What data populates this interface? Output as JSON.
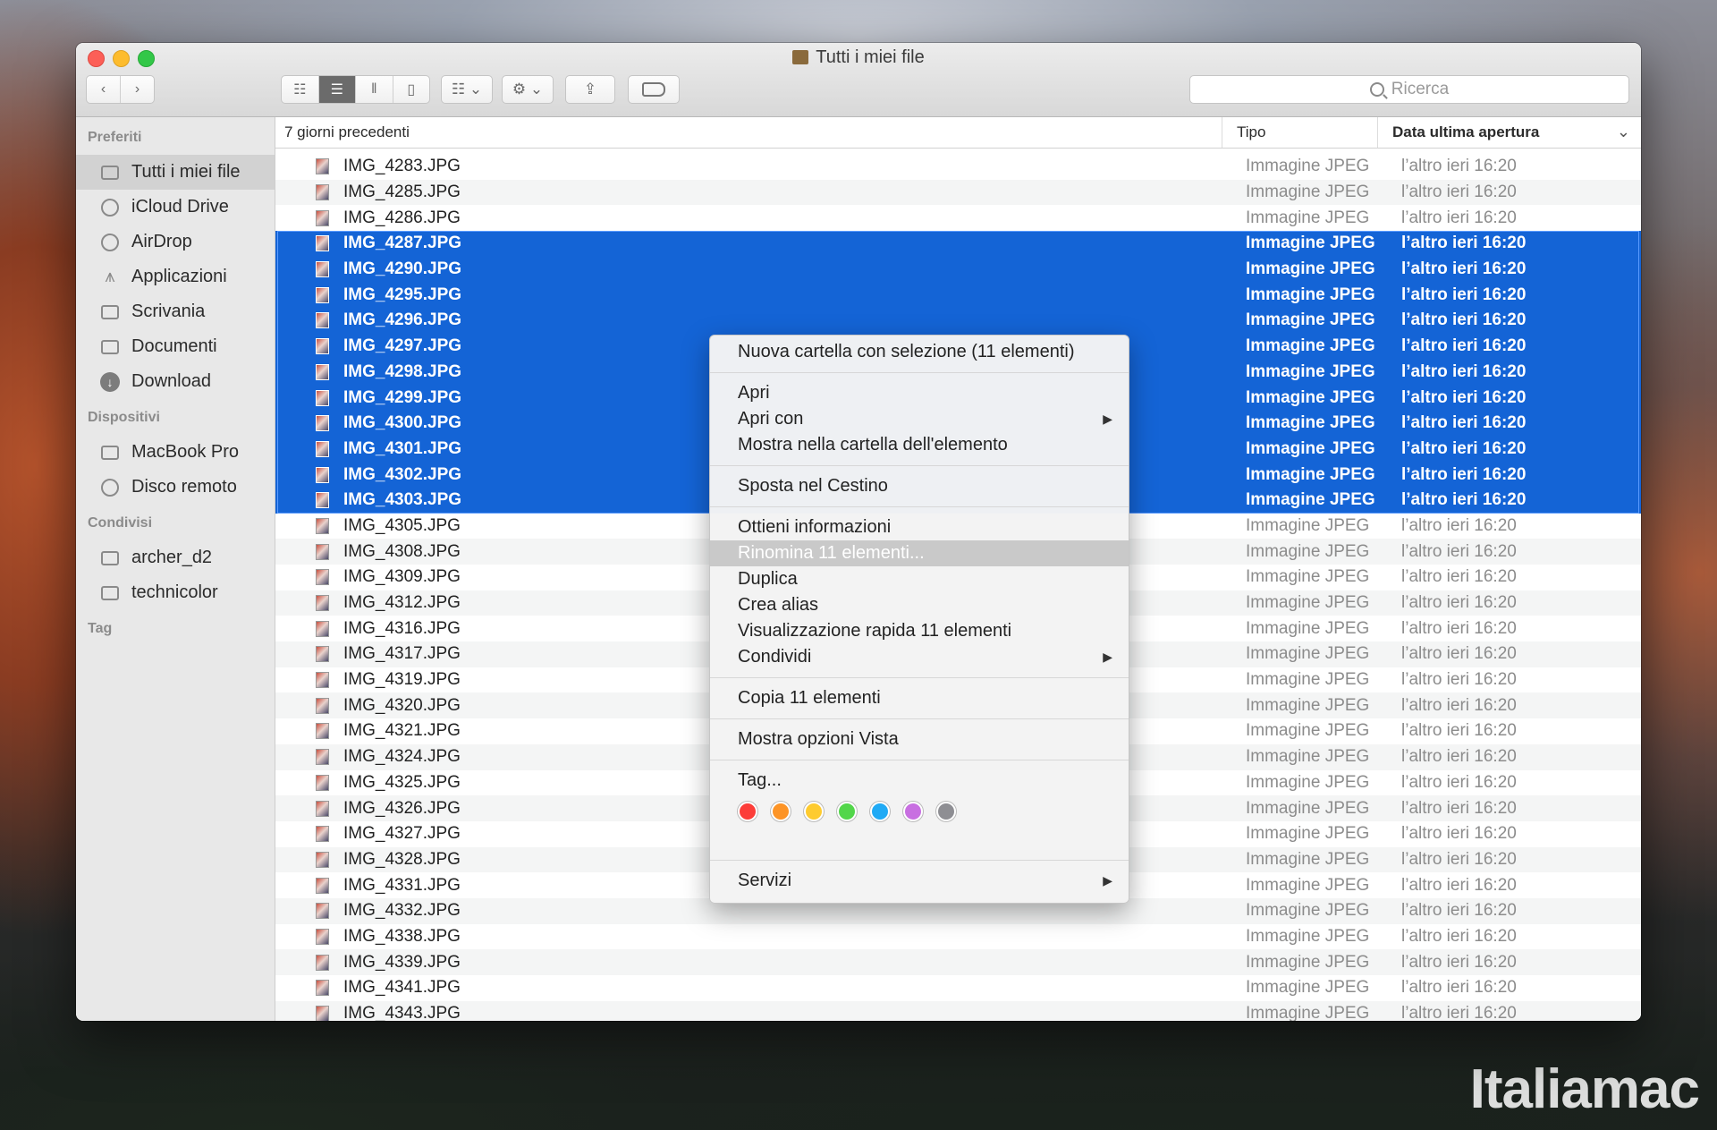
{
  "window": {
    "title": "Tutti i miei file"
  },
  "toolbar": {
    "back_icon": "chevron-left-icon",
    "forward_icon": "chevron-right-icon",
    "view_icons": [
      "icon-view",
      "list-view",
      "column-view",
      "cover-flow-view"
    ],
    "search_placeholder": "Ricerca"
  },
  "sidebar": {
    "favorites_header": "Preferiti",
    "favorites": [
      {
        "label": "Tutti i miei file",
        "icon": "all-files-icon"
      },
      {
        "label": "iCloud Drive",
        "icon": "cloud-icon"
      },
      {
        "label": "AirDrop",
        "icon": "airdrop-icon"
      },
      {
        "label": "Applicazioni",
        "icon": "applications-icon"
      },
      {
        "label": "Scrivania",
        "icon": "desktop-icon"
      },
      {
        "label": "Documenti",
        "icon": "documents-icon"
      },
      {
        "label": "Download",
        "icon": "download-icon"
      }
    ],
    "devices_header": "Dispositivi",
    "devices": [
      {
        "label": "MacBook Pro",
        "icon": "laptop-icon"
      },
      {
        "label": "Disco remoto",
        "icon": "disc-icon"
      }
    ],
    "shared_header": "Condivisi",
    "shared": [
      {
        "label": "archer_d2",
        "icon": "monitor-icon"
      },
      {
        "label": "technicolor",
        "icon": "monitor-icon"
      }
    ],
    "tags_header": "Tag"
  },
  "list": {
    "group_header": "7 giorni precedenti",
    "col_kind": "Tipo",
    "col_date": "Data ultima apertura",
    "kind_value": "Immagine JPEG",
    "date_value": "l’altro ieri 16:20",
    "files": [
      "IMG_4283.JPG",
      "IMG_4285.JPG",
      "IMG_4286.JPG",
      "IMG_4287.JPG",
      "IMG_4290.JPG",
      "IMG_4295.JPG",
      "IMG_4296.JPG",
      "IMG_4297.JPG",
      "IMG_4298.JPG",
      "IMG_4299.JPG",
      "IMG_4300.JPG",
      "IMG_4301.JPG",
      "IMG_4302.JPG",
      "IMG_4303.JPG",
      "IMG_4305.JPG",
      "IMG_4308.JPG",
      "IMG_4309.JPG",
      "IMG_4312.JPG",
      "IMG_4316.JPG",
      "IMG_4317.JPG",
      "IMG_4319.JPG",
      "IMG_4320.JPG",
      "IMG_4321.JPG",
      "IMG_4324.JPG",
      "IMG_4325.JPG",
      "IMG_4326.JPG",
      "IMG_4327.JPG",
      "IMG_4328.JPG",
      "IMG_4331.JPG",
      "IMG_4332.JPG",
      "IMG_4338.JPG",
      "IMG_4339.JPG",
      "IMG_4341.JPG",
      "IMG_4343.JPG"
    ],
    "selected_first": 3,
    "selected_last": 13
  },
  "context_menu": {
    "new_folder": "Nuova cartella con selezione (11 elementi)",
    "open": "Apri",
    "open_with": "Apri con",
    "show_in_folder": "Mostra nella cartella dell'elemento",
    "trash": "Sposta nel Cestino",
    "get_info": "Ottieni informazioni",
    "rename": "Rinomina 11 elementi...",
    "duplicate": "Duplica",
    "alias": "Crea alias",
    "quick_look": "Visualizzazione rapida 11 elementi",
    "share": "Condividi",
    "copy": "Copia 11 elementi",
    "view_options": "Mostra opzioni Vista",
    "tags": "Tag...",
    "tag_colors": [
      "#fc3d39",
      "#fd9426",
      "#fecb2f",
      "#52d64a",
      "#20aaf5",
      "#c86fe1",
      "#8e8e93"
    ],
    "services": "Servizi"
  },
  "watermark": "Italiamac"
}
